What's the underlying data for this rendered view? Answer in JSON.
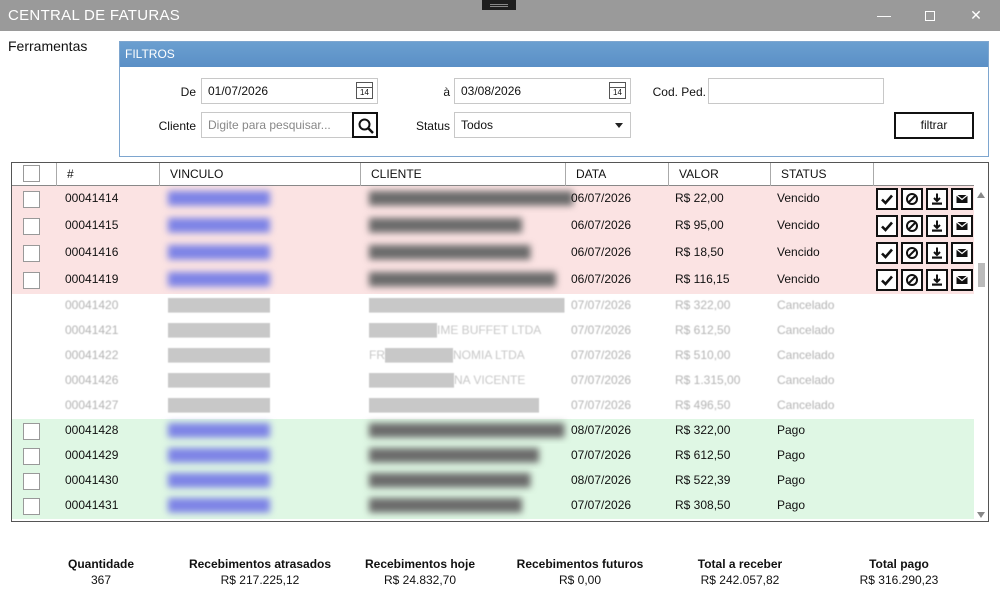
{
  "window": {
    "title": "CENTRAL DE FATURAS",
    "minimize": "—",
    "close": "✕"
  },
  "menu": {
    "tools": "Ferramentas"
  },
  "filters": {
    "header": "FILTROS",
    "from_label": "De",
    "from_value": "01/07/2026",
    "to_label": "à",
    "to_value": "03/08/2026",
    "calendar_day": "14",
    "order_code_label": "Cod. Ped.",
    "order_code_value": "",
    "client_label": "Cliente",
    "client_placeholder": "Digite para pesquisar...",
    "status_label": "Status",
    "status_value": "Todos",
    "filter_button": "filtrar"
  },
  "table": {
    "columns": [
      "#",
      "VINCULO",
      "CLIENTE",
      "DATA",
      "VALOR",
      "STATUS"
    ],
    "rows": [
      {
        "id": "00041414",
        "vinculo": "████████████",
        "cliente": "████████████████████████",
        "data": "06/07/2026",
        "valor": "R$ 22,00",
        "status": "Vencido",
        "kind": "venc"
      },
      {
        "id": "00041415",
        "vinculo": "████████████",
        "cliente": "██████████████████",
        "data": "06/07/2026",
        "valor": "R$ 95,00",
        "status": "Vencido",
        "kind": "venc"
      },
      {
        "id": "00041416",
        "vinculo": "████████████",
        "cliente": "███████████████████",
        "data": "06/07/2026",
        "valor": "R$ 18,50",
        "status": "Vencido",
        "kind": "venc"
      },
      {
        "id": "00041419",
        "vinculo": "████████████",
        "cliente": "██████████████████████",
        "data": "06/07/2026",
        "valor": "R$ 116,15",
        "status": "Vencido",
        "kind": "venc"
      },
      {
        "id": "00041420",
        "vinculo": "████████████",
        "cliente": "███████████████████████",
        "data": "07/07/2026",
        "valor": "R$ 322,00",
        "status": "Cancelado",
        "kind": "canc"
      },
      {
        "id": "00041421",
        "vinculo": "████████████",
        "cliente": "████████IME BUFFET LTDA",
        "data": "07/07/2026",
        "valor": "R$ 612,50",
        "status": "Cancelado",
        "kind": "canc"
      },
      {
        "id": "00041422",
        "vinculo": "████████████",
        "cliente": "FR████████NOMIA LTDA",
        "data": "07/07/2026",
        "valor": "R$ 510,00",
        "status": "Cancelado",
        "kind": "canc"
      },
      {
        "id": "00041426",
        "vinculo": "████████████",
        "cliente": "██████████NA VICENTE",
        "data": "07/07/2026",
        "valor": "R$ 1.315,00",
        "status": "Cancelado",
        "kind": "canc"
      },
      {
        "id": "00041427",
        "vinculo": "████████████",
        "cliente": "████████████████████",
        "data": "07/07/2026",
        "valor": "R$ 496,50",
        "status": "Cancelado",
        "kind": "canc"
      },
      {
        "id": "00041428",
        "vinculo": "████████████",
        "cliente": "███████████████████████",
        "data": "08/07/2026",
        "valor": "R$ 322,00",
        "status": "Pago",
        "kind": "pago"
      },
      {
        "id": "00041429",
        "vinculo": "████████████",
        "cliente": "████████████████████",
        "data": "07/07/2026",
        "valor": "R$ 612,50",
        "status": "Pago",
        "kind": "pago"
      },
      {
        "id": "00041430",
        "vinculo": "████████████",
        "cliente": "███████████████████",
        "data": "08/07/2026",
        "valor": "R$ 522,39",
        "status": "Pago",
        "kind": "pago"
      },
      {
        "id": "00041431",
        "vinculo": "████████████",
        "cliente": "██████████████████",
        "data": "07/07/2026",
        "valor": "R$ 308,50",
        "status": "Pago",
        "kind": "pago"
      }
    ],
    "colors": {
      "vencido": "#fbe3e3",
      "pago": "#dff7e4",
      "cancelado": "#ffffff"
    },
    "action_icons": [
      "check-icon",
      "cancel-icon",
      "download-icon",
      "email-icon"
    ]
  },
  "summary": [
    {
      "title": "Quantidade",
      "value": "367"
    },
    {
      "title": "Recebimentos atrasados",
      "value": "R$ 217.225,12"
    },
    {
      "title": "Recebimentos hoje",
      "value": "R$ 24.832,70"
    },
    {
      "title": "Recebimentos futuros",
      "value": "R$ 0,00"
    },
    {
      "title": "Total a receber",
      "value": "R$ 242.057,82"
    },
    {
      "title": "Total pago",
      "value": "R$ 316.290,23"
    }
  ]
}
